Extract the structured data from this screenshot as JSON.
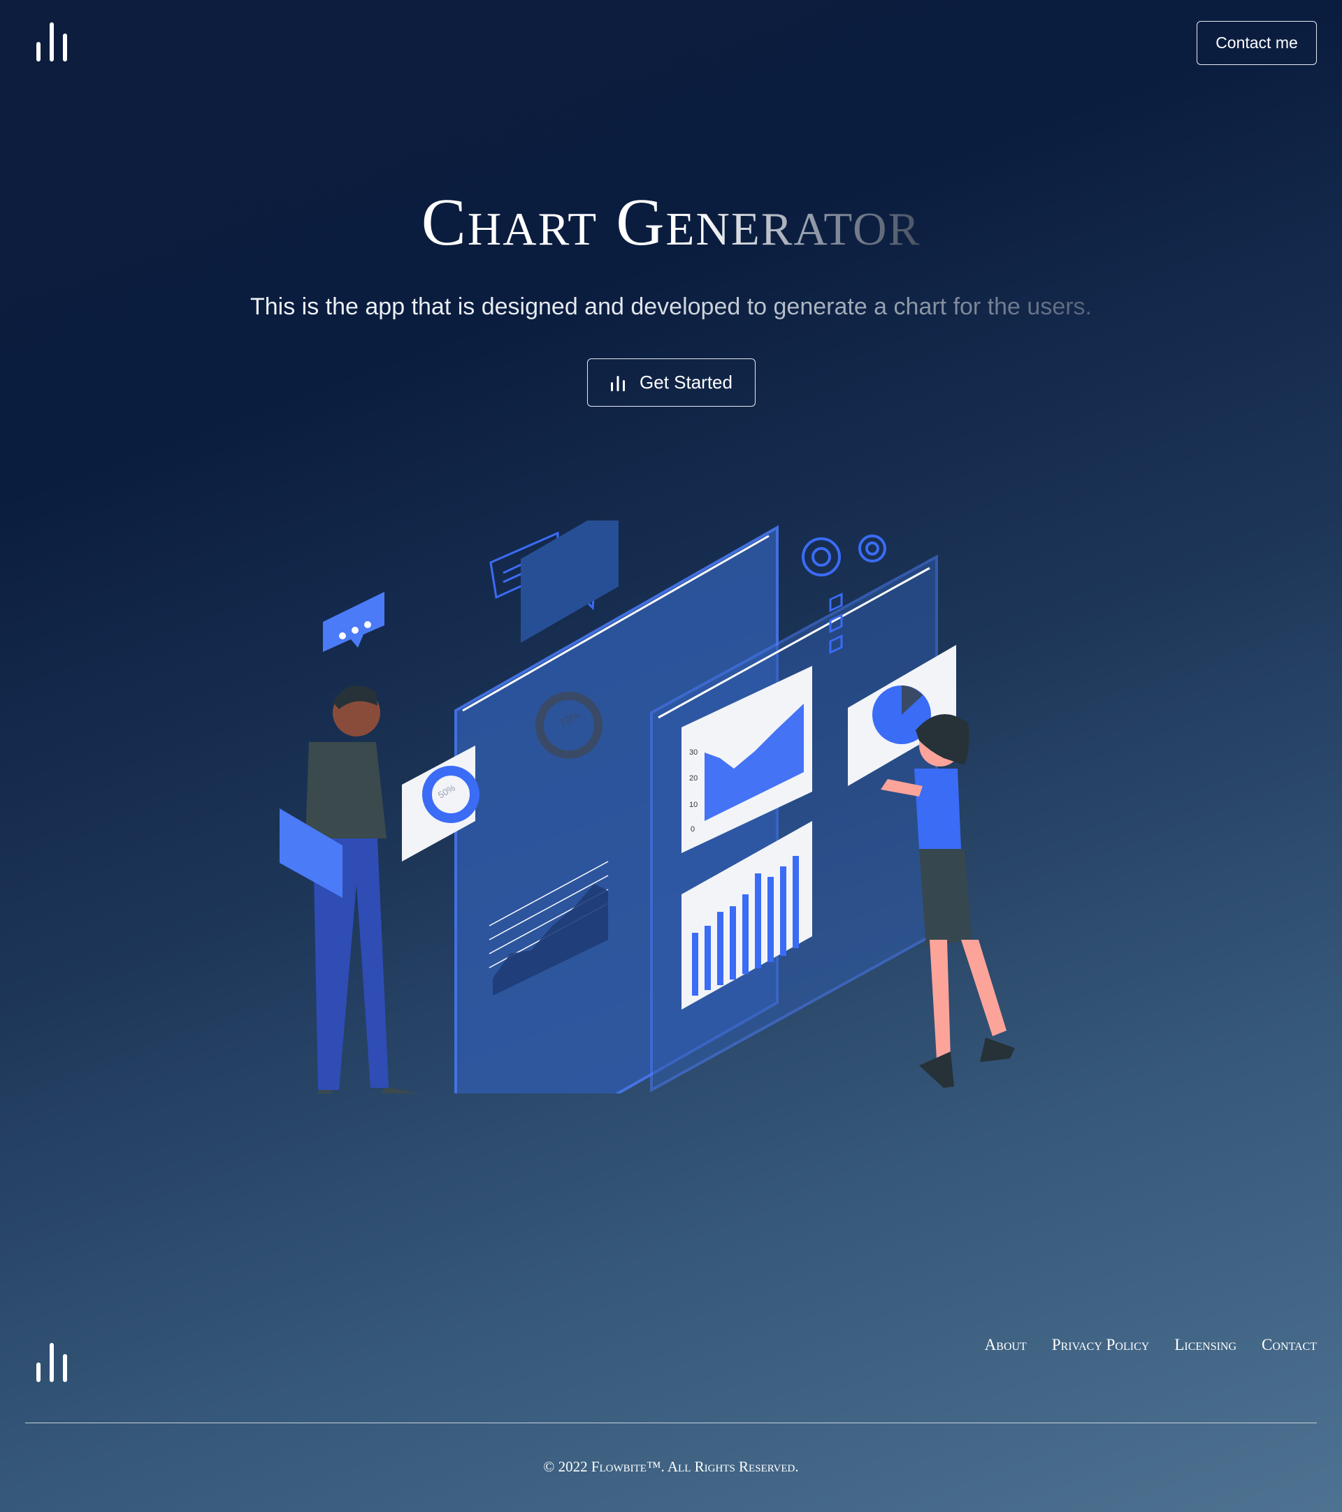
{
  "header": {
    "logo_icon": "bar-chart-icon",
    "contact_label": "Contact me"
  },
  "hero": {
    "title": "Chart Generator",
    "subtitle": "This is the app that is designed and developed to generate a chart for the users.",
    "cta_icon": "bar-chart-icon",
    "cta_label": "Get Started"
  },
  "illustration": {
    "axis_labels": [
      "30",
      "20",
      "10",
      "0"
    ],
    "donut_label": "70%",
    "gauge_label": "50%"
  },
  "footer": {
    "logo_icon": "bar-chart-icon",
    "links": [
      "About",
      "Privacy Policy",
      "Licensing",
      "Contact"
    ],
    "copyright": "© 2022 Flowbite™. All Rights Reserved."
  },
  "colors": {
    "accent_blue": "#3b6cf6",
    "panel_blue": "#2f5aa8",
    "background_top": "#0b1d3f",
    "background_bottom": "#4e7291"
  }
}
